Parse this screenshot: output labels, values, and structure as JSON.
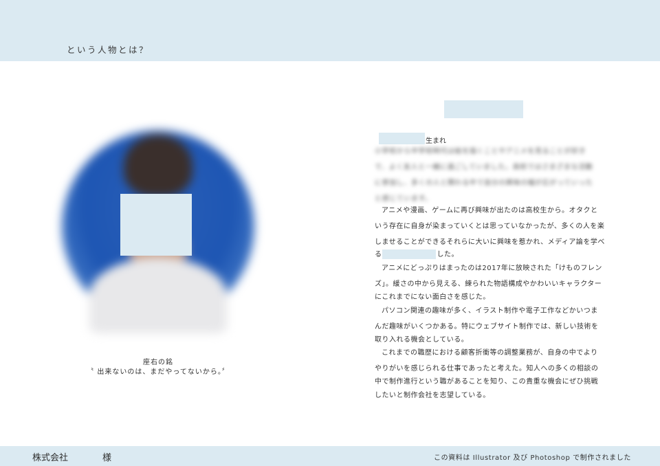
{
  "header": {
    "title": "という人物とは？"
  },
  "profile": {
    "motto_label": "座右の銘",
    "motto_text": "〝 出来ないのは、まだやってないから。〞"
  },
  "bio": {
    "birth_suffix": "生まれ",
    "blurred_paragraph": "小学校から中学校時代は絵を描くことやアニメを見ることが好きで、よく友人と一緒に過ごしていました。高校ではさまざまな活動に参加し、多くの人と関わる中で自分の興味の幅が広がっていったと感じています。",
    "lines": [
      "アニメや漫画、ゲームに再び興味が出たのは高校生から。オタクと",
      "いう存在に自身が染まっていくとは思っていなかったが、多くの人を楽",
      "しませることができるそれらに大いに興味を惹かれ、メディア論を学べ",
      "した。",
      "アニメにどっぷりはまったのは2017年に放映された「けものフレン",
      "ズ」。緩さの中から見える、練られた物語構成やかわいいキャラクター",
      "にこれまでにない面白さを感じた。",
      "パソコン関連の趣味が多く、イラスト制作や電子工作などかいつま",
      "んだ趣味がいくつかある。特にウェブサイト制作では、新しい技術を",
      "取り入れる機会としている。",
      "これまでの職歴における顧客折衝等の調整業務が、自身の中でより",
      "やりがいを感じられる仕事であったと考えた。知人への多くの相談の",
      "中で制作進行という職があることを知り、この貴重な機会にぜひ挑戦",
      "したいと制作会社を志望している。"
    ],
    "line_prefixes": [
      "",
      "",
      "",
      "る",
      "",
      "",
      "",
      "",
      "",
      "",
      "",
      "",
      "",
      ""
    ]
  },
  "footer": {
    "company": "株式会社",
    "honorific": "様",
    "note": "この資料は Illustrator 及び Photoshop で制作されました"
  },
  "colors": {
    "band": "#dbeaf2",
    "portrait_bg": "#1e56b3",
    "text": "#333333"
  }
}
